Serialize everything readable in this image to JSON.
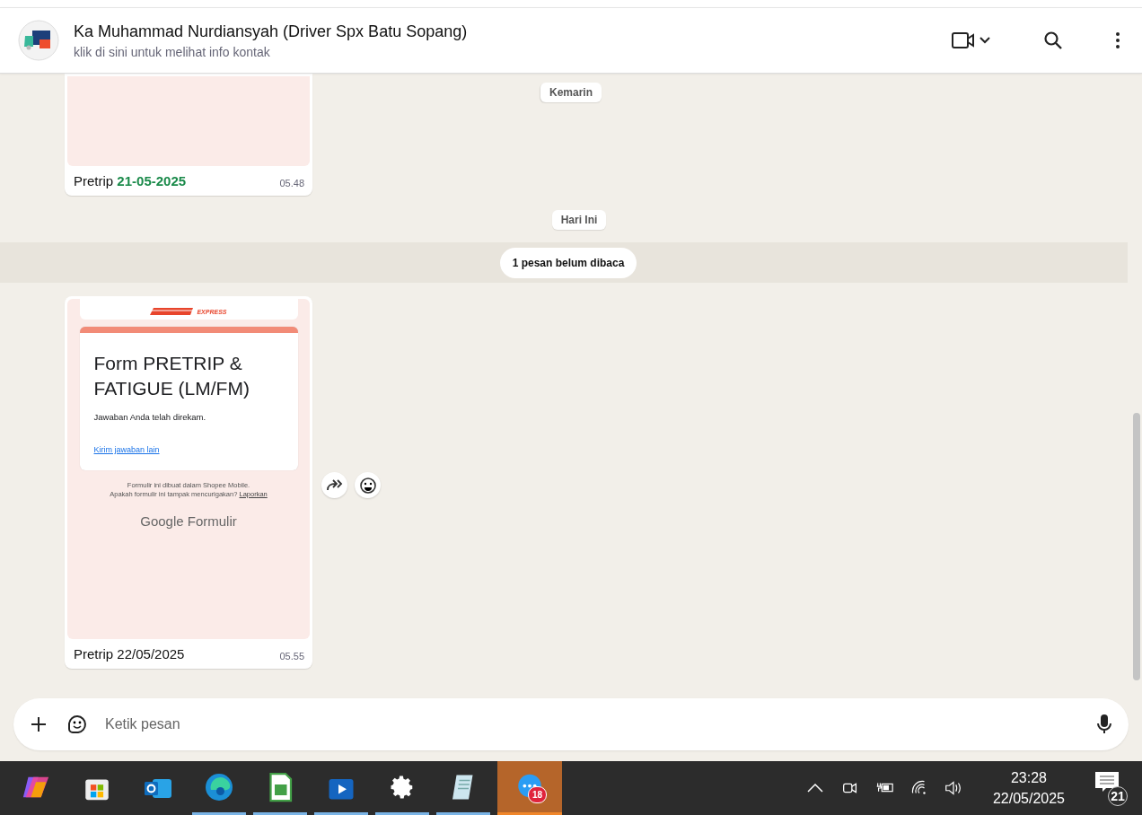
{
  "header": {
    "title": "Ka Muhammad Nurdiansyah (Driver Spx Batu Sopang)",
    "subtitle": "klik di sini untuk melihat info kontak"
  },
  "sticky_date": "Kemarin",
  "messages": [
    {
      "kind": "image",
      "caption": "Pretrip **21-05-2025**",
      "time": "05.48"
    },
    {
      "kind": "date",
      "text": "Hari Ini"
    },
    {
      "kind": "unread",
      "text": "1 pesan belum dibaca"
    },
    {
      "kind": "form",
      "caption": "Pretrip 22/05/2025",
      "time": "05.55",
      "form": {
        "logo_text": "EXPRESS",
        "title": "Form PRETRIP & FATIGUE (LM/FM)",
        "confirmation": "Jawaban Anda telah direkam.",
        "link": "Kirim jawaban lain",
        "footer": "Formulir ini dibuat dalam Shopee Mobile.",
        "report_question": "Apakah formulir ini tampak mencurigakan?",
        "report_link": "Laporkan",
        "brand": "Google Formulir"
      }
    }
  ],
  "composer": {
    "placeholder": "Ketik pesan"
  },
  "taskbar": {
    "apps": [
      {
        "kind": "copilot",
        "running": false,
        "selected": false
      },
      {
        "kind": "store",
        "running": false,
        "selected": false
      },
      {
        "kind": "mail",
        "running": false,
        "selected": false
      },
      {
        "kind": "browser",
        "running": true,
        "selected": false
      },
      {
        "kind": "spreadsheet",
        "running": true,
        "selected": false
      },
      {
        "kind": "video",
        "running": true,
        "selected": false
      },
      {
        "kind": "settings",
        "running": true,
        "selected": false
      },
      {
        "kind": "notepad",
        "running": true,
        "selected": false
      },
      {
        "kind": "chat",
        "running": true,
        "selected": true,
        "badge": "18"
      }
    ],
    "time": "23:28",
    "date": "22/05/2025",
    "notifications": "21"
  }
}
